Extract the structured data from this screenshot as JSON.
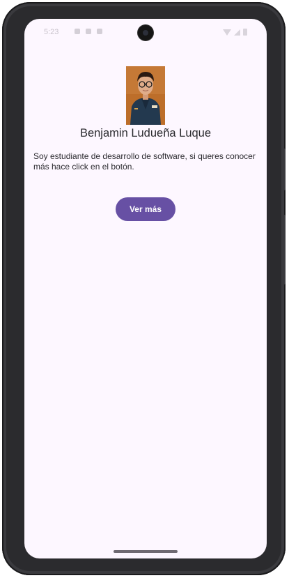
{
  "status_bar": {
    "time": "5:23"
  },
  "profile": {
    "name": "Benjamin Ludueña Luque",
    "description": "Soy estudiante de desarrollo de software, si queres conocer más hace click en el botón."
  },
  "actions": {
    "more_button_label": "Ver más"
  },
  "colors": {
    "background": "#fdf7ff",
    "primary": "#6750a4",
    "text": "#2a2a2e"
  },
  "icons": {
    "status": [
      "wifi-icon",
      "signal-icon",
      "battery-icon"
    ]
  }
}
